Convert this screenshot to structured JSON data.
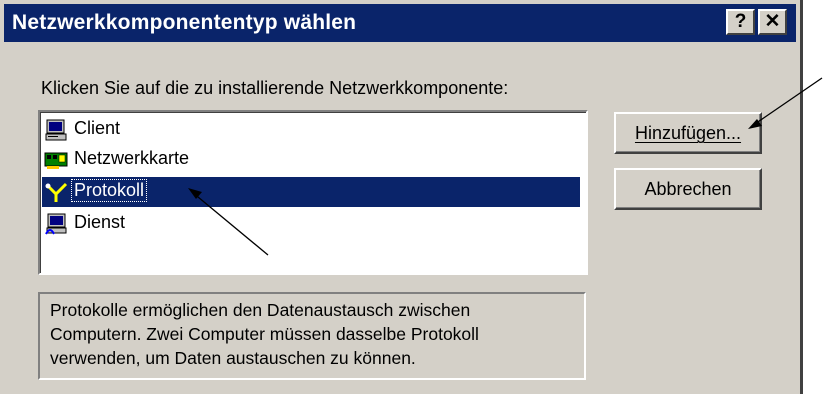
{
  "window": {
    "title": "Netzwerkkomponententyp wählen",
    "help_button": "?",
    "close_button": "✕"
  },
  "instruction": "Klicken Sie auf die zu installierende Netzwerkkomponente:",
  "list": {
    "items": [
      {
        "label": "Client",
        "icon": "computer-icon",
        "selected": false
      },
      {
        "label": "Netzwerkkarte",
        "icon": "network-card-icon",
        "selected": false
      },
      {
        "label": "Protokoll",
        "icon": "protocol-icon",
        "selected": true
      },
      {
        "label": "Dienst",
        "icon": "service-icon",
        "selected": false
      }
    ]
  },
  "buttons": {
    "add_label": "Hinzufügen...",
    "cancel_label": "Abbrechen"
  },
  "description": {
    "lines": [
      "Protokolle ermöglichen den Datenaustausch zwischen",
      "Computern. Zwei Computer müssen dasselbe Protokoll",
      "verwenden, um Daten austauschen zu können."
    ]
  },
  "colors": {
    "title_bar": "#0a246a",
    "dialog_face": "#d4d0c8",
    "selection": "#0a246a"
  }
}
